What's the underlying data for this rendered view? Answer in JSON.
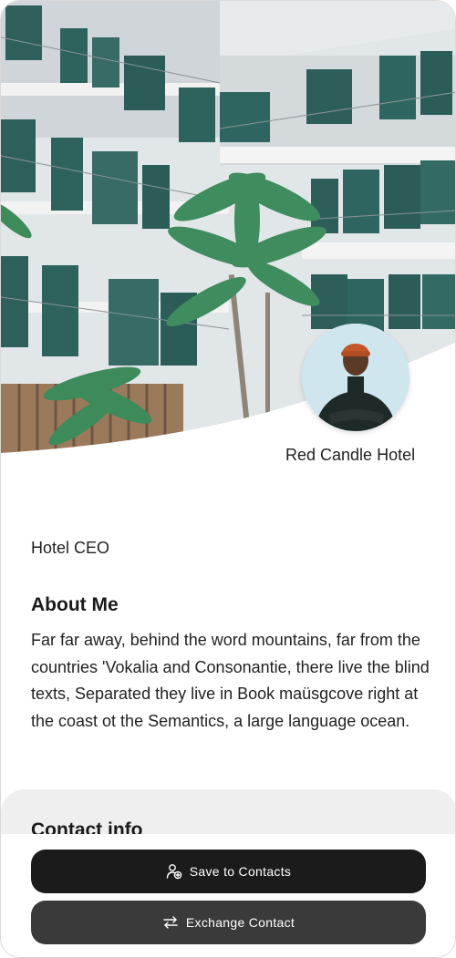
{
  "profile": {
    "company": "Red Candle Hotel",
    "role": "Hotel CEO"
  },
  "about": {
    "title": "About Me",
    "text": "Far far away, behind the word mountains, far from the countries 'Vokalia and Consonantie, there live the blind texts, Separated they live in Book maüsgcove right at the coast ot the Semantics, a large language ocean."
  },
  "contact": {
    "title": "Contact info"
  },
  "actions": {
    "save_label": "Save to Contacts",
    "exchange_label": "Exchange Contact"
  },
  "icons": {
    "save": "user-plus-icon",
    "exchange": "swap-arrows-icon"
  },
  "colors": {
    "save_button": "#1b1b1b",
    "exchange_button": "#3a3a3a",
    "contact_panel": "#efefef"
  }
}
